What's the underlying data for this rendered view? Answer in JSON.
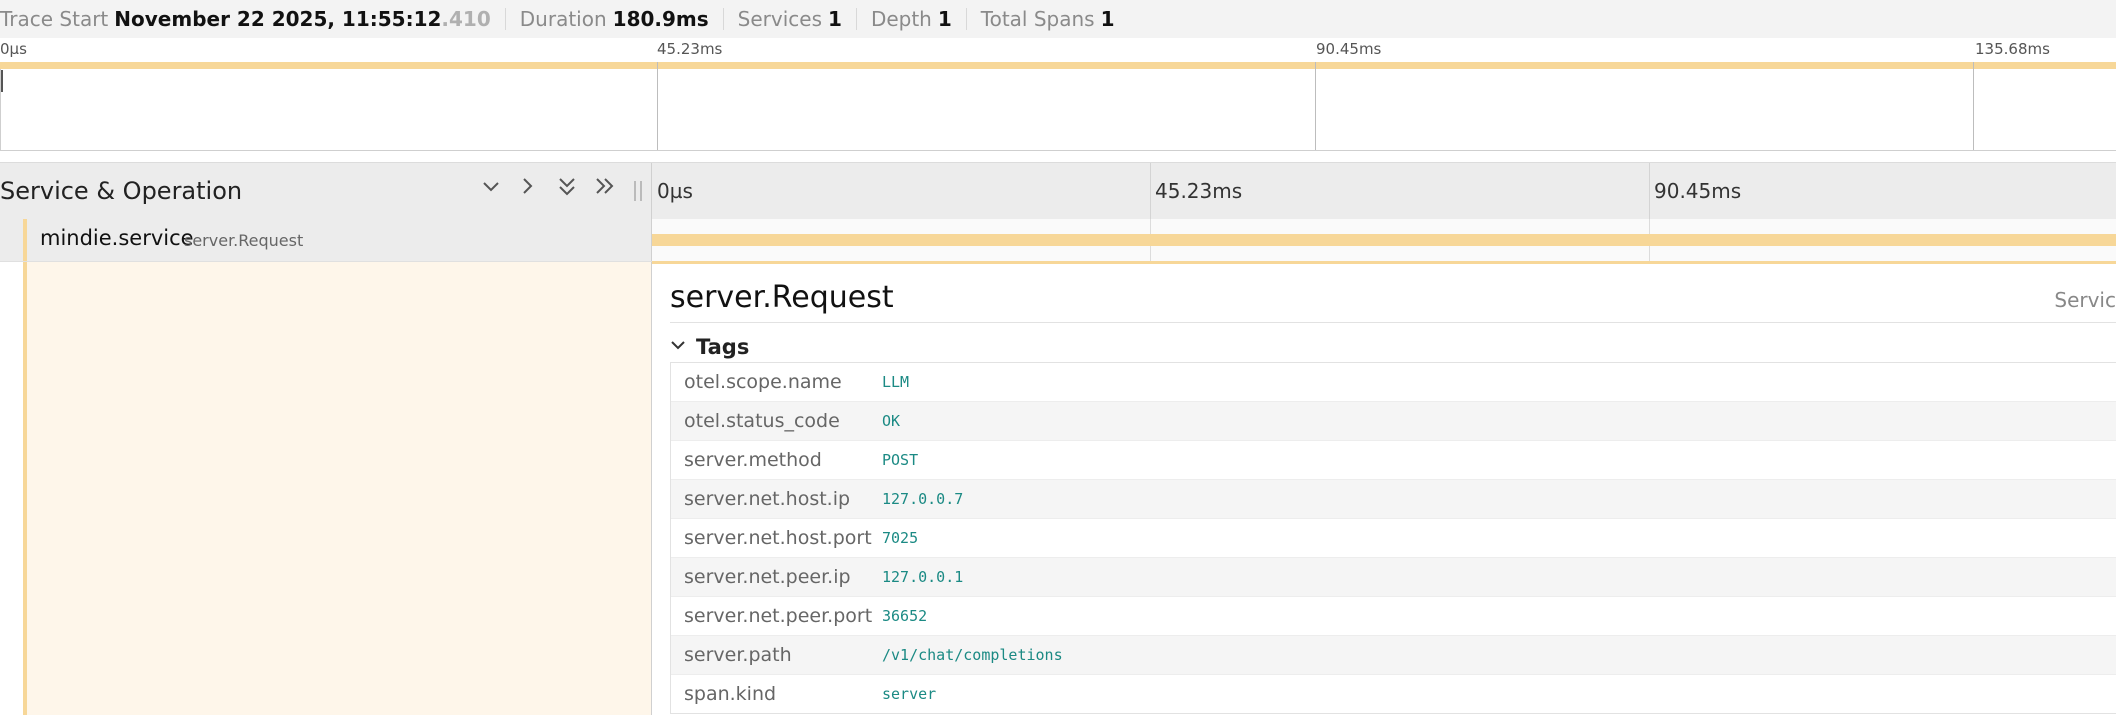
{
  "trace": {
    "start_label": "Trace Start",
    "start_date": "November 22 2025, 11:55:12",
    "start_ms": ".410",
    "duration_label": "Duration",
    "duration_value": "180.9ms",
    "services_label": "Services",
    "services_value": "1",
    "depth_label": "Depth",
    "depth_value": "1",
    "total_spans_label": "Total Spans",
    "total_spans_value": "1"
  },
  "minimap": {
    "ticks": [
      "0µs",
      "45.23ms",
      "90.45ms",
      "135.68ms"
    ]
  },
  "timeline": {
    "title": "Service & Operation",
    "ticks": [
      "0µs",
      "45.23ms",
      "90.45ms"
    ]
  },
  "span": {
    "service": "mindie.service",
    "operation": "server.Request",
    "color": "#f7d798"
  },
  "detail": {
    "title": "server.Request",
    "service_label": "Servic",
    "tags_label": "Tags",
    "tags": [
      {
        "key": "otel.scope.name",
        "value": "LLM"
      },
      {
        "key": "otel.status_code",
        "value": "OK"
      },
      {
        "key": "server.method",
        "value": "POST"
      },
      {
        "key": "server.net.host.ip",
        "value": "127.0.0.7"
      },
      {
        "key": "server.net.host.port",
        "value": "7025"
      },
      {
        "key": "server.net.peer.ip",
        "value": "127.0.0.1"
      },
      {
        "key": "server.net.peer.port",
        "value": "36652"
      },
      {
        "key": "server.path",
        "value": "/v1/chat/completions"
      },
      {
        "key": "span.kind",
        "value": "server"
      }
    ]
  },
  "icons": {
    "collapse_one": "chevron-down-icon",
    "expand_one": "chevron-right-icon",
    "collapse_all": "double-chevron-down-icon",
    "expand_all": "double-chevron-right-icon"
  }
}
